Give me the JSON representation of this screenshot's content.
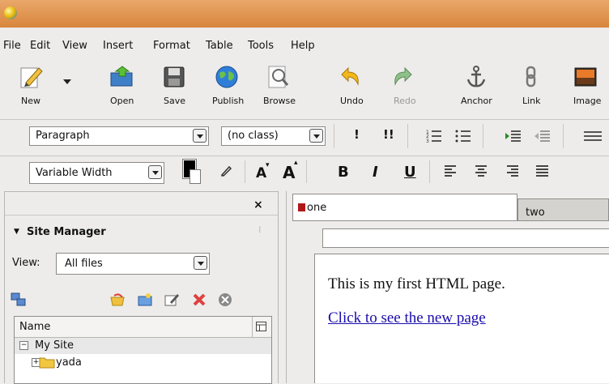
{
  "menubar": {
    "items": [
      "File",
      "Edit",
      "View",
      "Insert",
      "Format",
      "Table",
      "Tools",
      "Help"
    ]
  },
  "toolbar": {
    "buttons": [
      {
        "label": "New",
        "icon": "pencil-icon"
      },
      {
        "label": "Open",
        "icon": "open-folder-icon"
      },
      {
        "label": "Save",
        "icon": "floppy-disk-icon"
      },
      {
        "label": "Publish",
        "icon": "globe-icon"
      },
      {
        "label": "Browse",
        "icon": "magnifier-icon"
      },
      {
        "label": "Undo",
        "icon": "undo-arrow-icon"
      },
      {
        "label": "Redo",
        "icon": "redo-arrow-icon"
      },
      {
        "label": "Anchor",
        "icon": "anchor-icon"
      },
      {
        "label": "Link",
        "icon": "chain-link-icon"
      },
      {
        "label": "Image",
        "icon": "picture-icon"
      }
    ]
  },
  "format_toolbar": {
    "paragraph_format": "Paragraph",
    "css_class": "(no class)",
    "emphasis": "!",
    "strong": "!!"
  },
  "text_toolbar": {
    "font": "Variable Width",
    "smaller": "A",
    "larger": "A",
    "bold": "B",
    "italic": "I",
    "underline": "U"
  },
  "colors": {
    "titlebar": "#d9853d",
    "link": "#1a0dab",
    "tab_icon": "#b01818"
  },
  "site_manager": {
    "title": "Site Manager",
    "view_label": "View:",
    "view_value": "All files",
    "column_name": "Name",
    "tree": {
      "root": "My Site",
      "child": "yada"
    }
  },
  "editor": {
    "tabs": [
      "one",
      "two"
    ],
    "content": {
      "paragraph": "This is my first HTML page.",
      "link": "Click to see the new page"
    }
  }
}
